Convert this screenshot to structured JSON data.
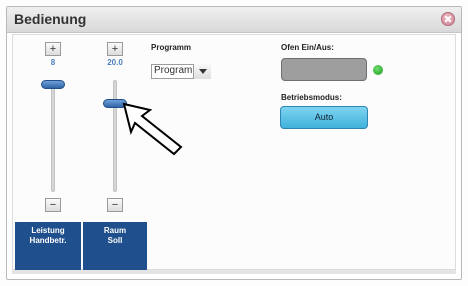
{
  "window": {
    "title": "Bedienung"
  },
  "sliders": [
    {
      "plus": "+",
      "value": "8",
      "minus": "−",
      "label_line1": "Leistung",
      "label_line2": "Handbetr."
    },
    {
      "plus": "+",
      "value": "20.0",
      "minus": "−",
      "label_line1": "Raum",
      "label_line2": "Soll"
    }
  ],
  "program": {
    "label": "Programm",
    "selected": "Program"
  },
  "oven": {
    "label": "Ofen Ein/Aus:",
    "status_color": "#2aa52a"
  },
  "mode": {
    "label": "Betriebsmodus:",
    "button": "Auto"
  },
  "colors": {
    "accent": "#1f4f8c",
    "auto_button": "#4fbde4"
  }
}
